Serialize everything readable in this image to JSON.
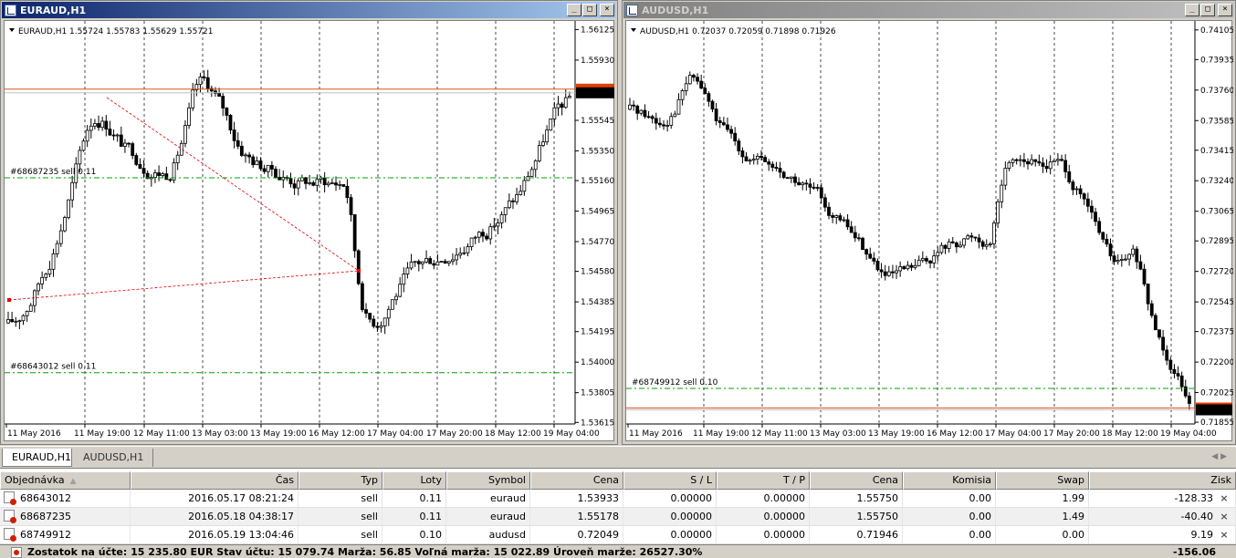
{
  "windows": [
    {
      "title": "EURAUD,H1",
      "active": true,
      "info": "EURAUD,H1  1.55724 1.55783 1.55629 1.55721",
      "price_labels": [
        "1.56125",
        "1.55930",
        "1.55721",
        "1.55545",
        "1.55350",
        "1.55160",
        "1.54965",
        "1.54770",
        "1.54580",
        "1.54385",
        "1.54195",
        "1.54000",
        "1.53805",
        "1.53615"
      ],
      "current_price": "1.55721",
      "time_labels": [
        "11 May 2016",
        "11 May 19:00",
        "12 May 11:00",
        "13 May 03:00",
        "13 May 19:00",
        "16 May 12:00",
        "17 May 04:00",
        "17 May 20:00",
        "18 May 12:00",
        "19 May 04:00"
      ],
      "order_lines": [
        {
          "label": "#68687235 sell 0.11",
          "price": 1.55178
        },
        {
          "label": "#68643012 sell 0.11",
          "price": 1.53933
        }
      ]
    },
    {
      "title": "AUDUSD,H1",
      "active": false,
      "info": "AUDUSD,H1  0.72037 0.72059 0.71898 0.71926",
      "price_labels": [
        "0.74105",
        "0.73935",
        "0.73760",
        "0.73585",
        "0.73415",
        "0.73240",
        "0.73065",
        "0.72895",
        "0.72720",
        "0.72545",
        "0.72375",
        "0.72200",
        "0.72025",
        "0.71926",
        "0.71855"
      ],
      "current_price": "0.71926",
      "time_labels": [
        "11 May 2016",
        "11 May 19:00",
        "12 May 11:00",
        "13 May 03:00",
        "13 May 19:00",
        "16 May 12:00",
        "17 May 04:00",
        "17 May 20:00",
        "18 May 12:00",
        "19 May 04:00"
      ],
      "order_lines": [
        {
          "label": "#68749912 sell 0.10",
          "price": 0.72049
        }
      ]
    }
  ],
  "tabs": [
    "EURAUD,H1",
    "AUDUSD,H1"
  ],
  "terminal": {
    "columns": [
      "Objednávka",
      "Čas",
      "Typ",
      "Loty",
      "Symbol",
      "Cena",
      "S / L",
      "T / P",
      "Cena",
      "Komisia",
      "Swap",
      "Zisk"
    ],
    "rows": [
      [
        "68643012",
        "2016.05.17 08:21:24",
        "sell",
        "0.11",
        "euraud",
        "1.53933",
        "0.00000",
        "0.00000",
        "1.55750",
        "0.00",
        "1.99",
        "-128.33"
      ],
      [
        "68687235",
        "2016.05.18 04:38:17",
        "sell",
        "0.11",
        "euraud",
        "1.55178",
        "0.00000",
        "0.00000",
        "1.55750",
        "0.00",
        "1.49",
        "-40.40"
      ],
      [
        "68749912",
        "2016.05.19 13:04:46",
        "sell",
        "0.10",
        "audusd",
        "0.72049",
        "0.00000",
        "0.00000",
        "0.71946",
        "0.00",
        "0.00",
        "9.19"
      ]
    ],
    "balance_text": "Zostatok na účte: 15 235.80 EUR  Stav účtu: 15 079.74  Marža: 56.85  Voľná marža: 15 022.89  Úroveň marže: 26527.30%",
    "total_profit": "-156.06"
  },
  "colors": {
    "candle": "#000000",
    "bid_line": "#c0c0c0",
    "ask_line": "#e05020",
    "order_line": "#00a000",
    "arrow": "#e00000",
    "active_title": "#0a246a",
    "price_marker": "#e04000"
  }
}
